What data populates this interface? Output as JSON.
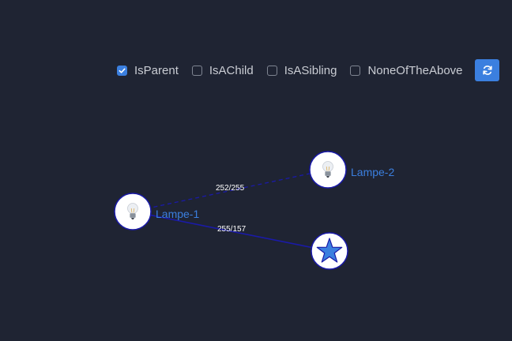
{
  "filters": [
    {
      "label": "IsParent",
      "checked": true
    },
    {
      "label": "IsAChild",
      "checked": false
    },
    {
      "label": "IsASibling",
      "checked": false
    },
    {
      "label": "NoneOfTheAbove",
      "checked": false
    }
  ],
  "refresh_icon": "refresh-icon",
  "graph": {
    "nodes": [
      {
        "id": "lampe-1",
        "label": "Lampe-1",
        "icon": "lightbulb-icon"
      },
      {
        "id": "lampe-2",
        "label": "Lampe-2",
        "icon": "lightbulb-icon"
      },
      {
        "id": "star",
        "label": "",
        "icon": "star-icon"
      }
    ],
    "edges": [
      {
        "from": "lampe-1",
        "to": "lampe-2",
        "label": "252/255",
        "style": "dashed"
      },
      {
        "from": "lampe-1",
        "to": "star",
        "label": "255/157",
        "style": "solid"
      }
    ]
  },
  "colors": {
    "background": "#1f2433",
    "accent": "#3b7fdf",
    "edge": "#1a1aa8",
    "node_fill": "#ffffff",
    "node_border": "#1a1aa8",
    "star": "#3b7fdf"
  }
}
